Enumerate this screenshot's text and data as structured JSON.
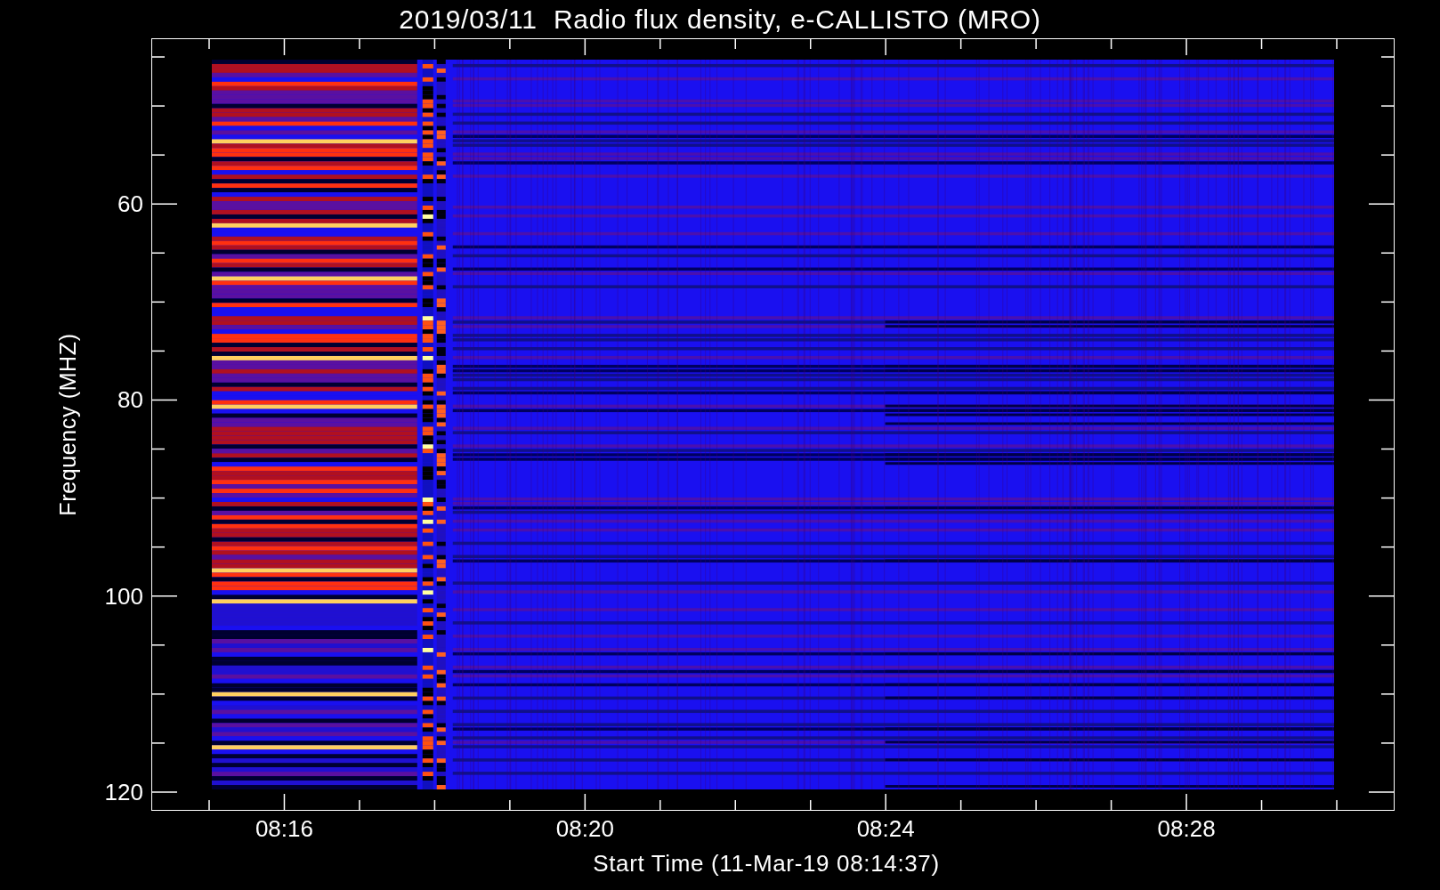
{
  "title": "2019/03/11  Radio flux density, e-CALLISTO (MRO)",
  "y_axis": {
    "label": "Frequency (MHZ)",
    "tick_labels": [
      "60",
      "80",
      "100",
      "120"
    ]
  },
  "x_axis": {
    "label": "Start Time (11-Mar-19 08:14:37)",
    "tick_labels": [
      "08:16",
      "08:20",
      "08:24",
      "08:28"
    ]
  }
}
